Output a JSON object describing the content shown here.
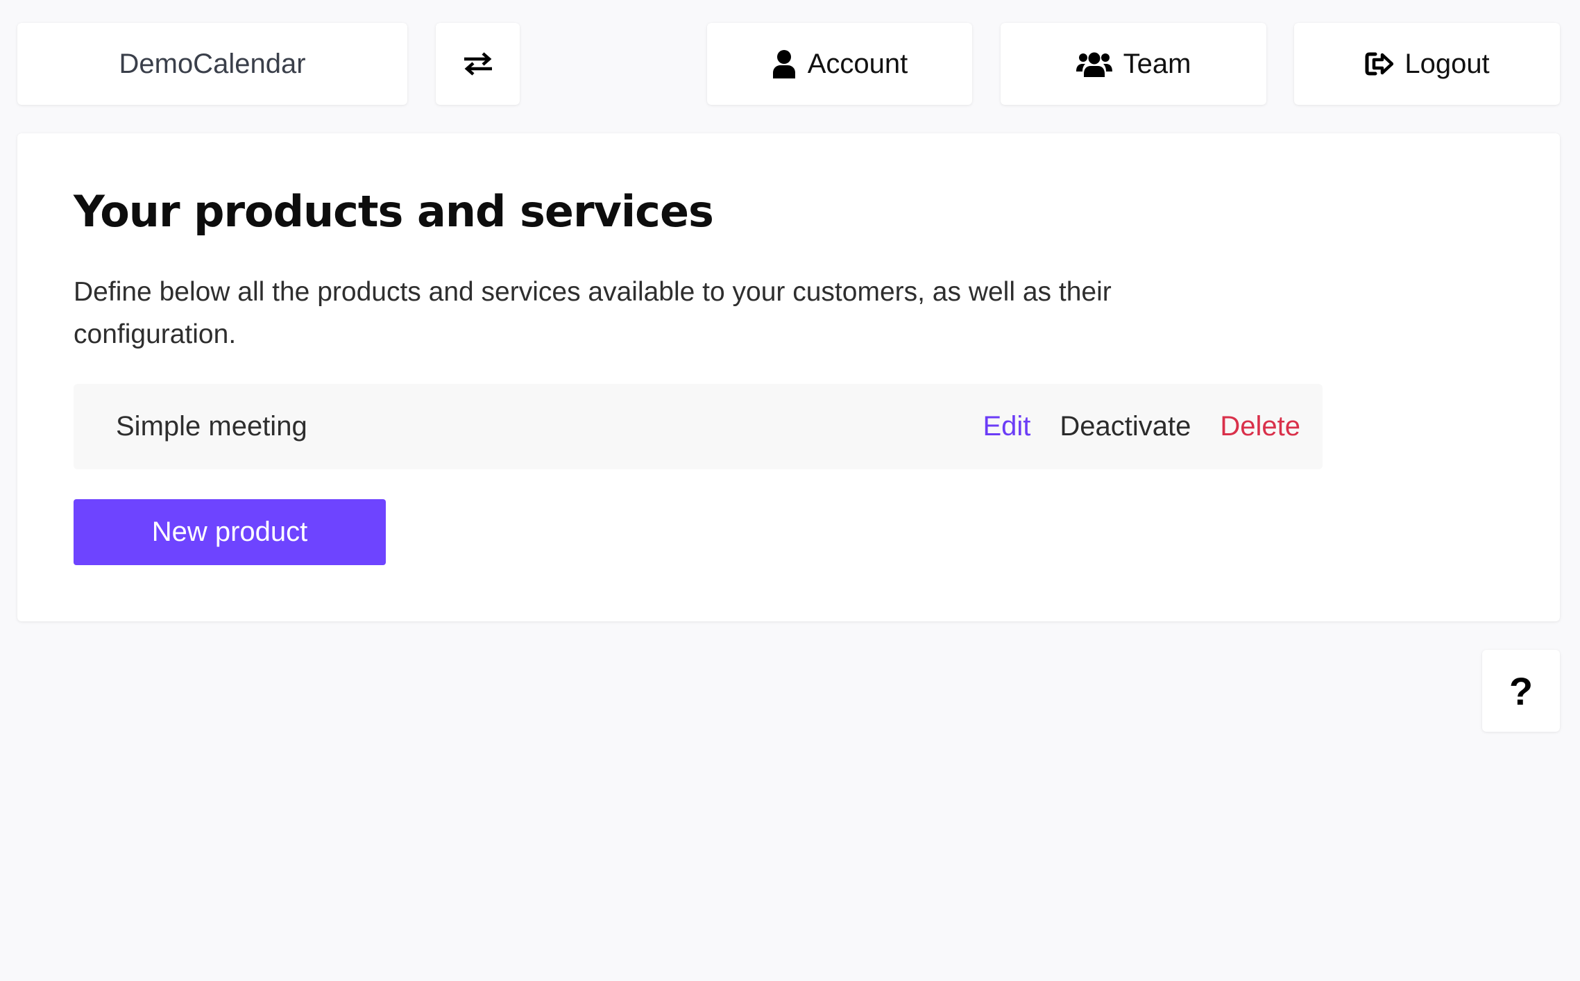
{
  "nav": {
    "brand": "DemoCalendar",
    "switch_icon": "swap-arrows-icon",
    "account": {
      "label": "Account",
      "icon": "user-icon"
    },
    "team": {
      "label": "Team",
      "icon": "users-icon"
    },
    "logout": {
      "label": "Logout",
      "icon": "sign-out-icon"
    }
  },
  "main": {
    "title": "Your products and services",
    "description": "Define below all the products and services available to your customers, as well as their configuration.",
    "products": [
      {
        "name": "Simple meeting",
        "actions": {
          "edit": "Edit",
          "deactivate": "Deactivate",
          "delete": "Delete"
        }
      }
    ],
    "new_button": "New product"
  },
  "help": {
    "label": "?",
    "icon": "question-icon"
  },
  "colors": {
    "accent": "#6e44ff",
    "edit_link": "#6b3cf6",
    "delete_link": "#d9304a",
    "background": "#f9f9fb"
  }
}
